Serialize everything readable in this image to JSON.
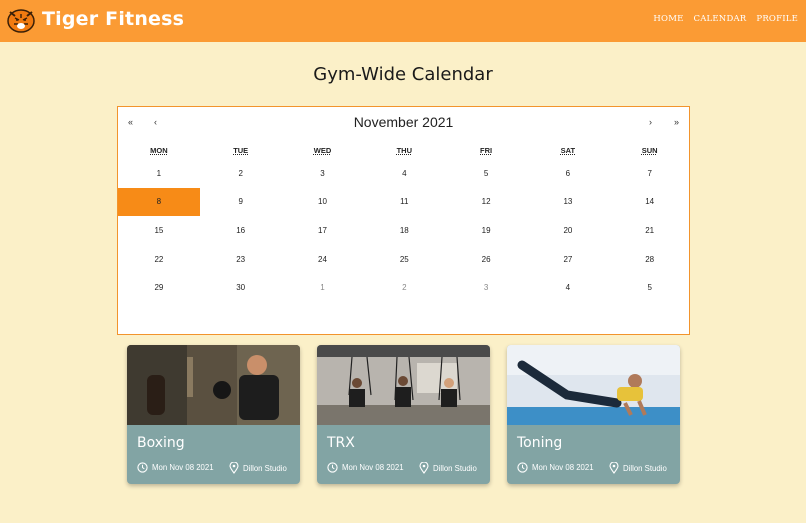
{
  "header": {
    "brand": "Tiger Fitness",
    "nav": [
      "HOME",
      "CALENDAR",
      "PROFILE"
    ]
  },
  "page": {
    "title": "Gym-Wide Calendar"
  },
  "calendar": {
    "month_label": "November 2021",
    "nav": {
      "prev_year": "«",
      "prev_month": "‹",
      "next_month": "›",
      "next_year": "»"
    },
    "weekdays": [
      "MON",
      "TUE",
      "WED",
      "THU",
      "FRI",
      "SAT",
      "SUN"
    ],
    "weeks": [
      [
        "1",
        "2",
        "3",
        "4",
        "5",
        "6",
        "7"
      ],
      [
        "8",
        "9",
        "10",
        "11",
        "12",
        "13",
        "14"
      ],
      [
        "15",
        "16",
        "17",
        "18",
        "19",
        "20",
        "21"
      ],
      [
        "22",
        "23",
        "24",
        "25",
        "26",
        "27",
        "28"
      ],
      [
        "29",
        "30",
        "1",
        "2",
        "3",
        "4",
        "5"
      ]
    ],
    "selected_day": "8"
  },
  "classes": [
    {
      "name": "Boxing",
      "date": "Mon Nov 08 2021",
      "location": "Dillon Studio"
    },
    {
      "name": "TRX",
      "date": "Mon Nov 08 2021",
      "location": "Dillon Studio"
    },
    {
      "name": "Toning",
      "date": "Mon Nov 08 2021",
      "location": "Dillon Studio"
    }
  ],
  "colors": {
    "header": "#fb9b34",
    "background": "#fbf0c8",
    "selected": "#f78b17",
    "card": "#82a4a4"
  },
  "icons": [
    "tiger-logo-icon",
    "clock-icon",
    "location-pin-icon"
  ]
}
